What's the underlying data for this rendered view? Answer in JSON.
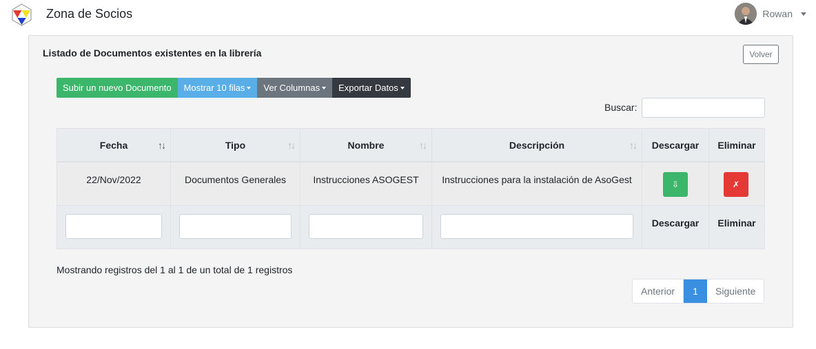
{
  "app": {
    "brand": "Zona de Socios",
    "logo_icon": "triangle-logo-icon"
  },
  "user": {
    "name": "Rowan"
  },
  "card": {
    "title": "Listado de Documentos existentes en la librería",
    "back_label": "Volver"
  },
  "toolbar": {
    "upload_label": "Subir un nuevo Documento",
    "rows_label": "Mostrar 10 filas",
    "columns_label": "Ver Columnas",
    "export_label": "Exportar Datos"
  },
  "search": {
    "label": "Buscar:",
    "value": ""
  },
  "table": {
    "headers": [
      "Fecha",
      "Tipo",
      "Nombre",
      "Descripción",
      "Descargar",
      "Eliminar"
    ],
    "rows": [
      {
        "fecha": "22/Nov/2022",
        "tipo": "Documentos Generales",
        "nombre": "Instrucciones ASOGEST",
        "descripcion": "Instrucciones para la instalación de AsoGest",
        "download_glyph": "⇩",
        "delete_glyph": "✗"
      }
    ],
    "footer": {
      "download": "Descargar",
      "delete": "Eliminar"
    }
  },
  "info": "Mostrando registros del 1 al 1 de un total de 1 registros",
  "pagination": {
    "prev": "Anterior",
    "current": "1",
    "next": "Siguiente"
  },
  "colors": {
    "green": "#3cb66b",
    "blue": "#5aaee8",
    "gray": "#6c757d",
    "dark": "#343a40",
    "red": "#e53935",
    "page_active": "#3a8fe0"
  }
}
